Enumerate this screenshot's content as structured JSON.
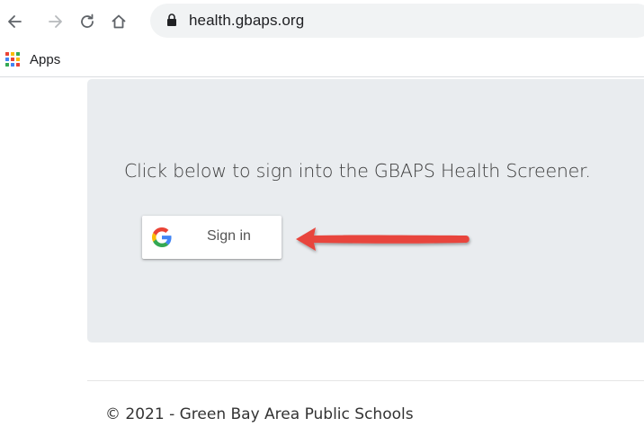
{
  "browser": {
    "url": "health.gbaps.org",
    "nav_icons": [
      "back-arrow-icon",
      "forward-arrow-icon",
      "reload-icon",
      "home-icon",
      "lock-icon"
    ]
  },
  "bookmarks": {
    "apps_label": "Apps",
    "apps_icon": "apps-grid-icon"
  },
  "main": {
    "lead": "Click below to sign into the GBAPS Health Screener.",
    "signin_label": "Sign in",
    "signin_icon": "google-logo-icon",
    "annotation_icon": "red-arrow-icon"
  },
  "footer": {
    "text": "© 2021 - Green Bay Area Public Schools"
  },
  "colors": {
    "jumbotron_bg": "#e9ecef",
    "annotation_arrow": "#e8453c",
    "omnibox_bg": "#f1f3f4"
  }
}
